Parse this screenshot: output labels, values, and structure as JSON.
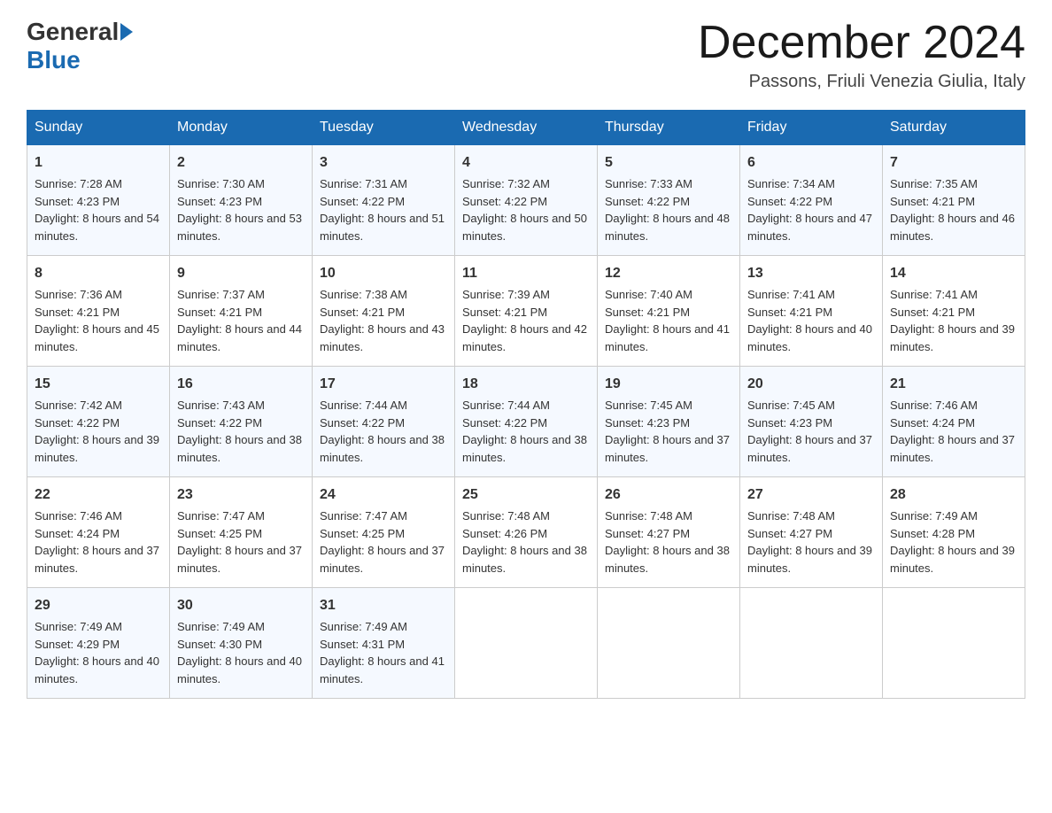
{
  "logo": {
    "general": "General",
    "blue": "Blue"
  },
  "title": "December 2024",
  "location": "Passons, Friuli Venezia Giulia, Italy",
  "days_of_week": [
    "Sunday",
    "Monday",
    "Tuesday",
    "Wednesday",
    "Thursday",
    "Friday",
    "Saturday"
  ],
  "weeks": [
    [
      {
        "day": "1",
        "sunrise": "7:28 AM",
        "sunset": "4:23 PM",
        "daylight": "8 hours and 54 minutes."
      },
      {
        "day": "2",
        "sunrise": "7:30 AM",
        "sunset": "4:23 PM",
        "daylight": "8 hours and 53 minutes."
      },
      {
        "day": "3",
        "sunrise": "7:31 AM",
        "sunset": "4:22 PM",
        "daylight": "8 hours and 51 minutes."
      },
      {
        "day": "4",
        "sunrise": "7:32 AM",
        "sunset": "4:22 PM",
        "daylight": "8 hours and 50 minutes."
      },
      {
        "day": "5",
        "sunrise": "7:33 AM",
        "sunset": "4:22 PM",
        "daylight": "8 hours and 48 minutes."
      },
      {
        "day": "6",
        "sunrise": "7:34 AM",
        "sunset": "4:22 PM",
        "daylight": "8 hours and 47 minutes."
      },
      {
        "day": "7",
        "sunrise": "7:35 AM",
        "sunset": "4:21 PM",
        "daylight": "8 hours and 46 minutes."
      }
    ],
    [
      {
        "day": "8",
        "sunrise": "7:36 AM",
        "sunset": "4:21 PM",
        "daylight": "8 hours and 45 minutes."
      },
      {
        "day": "9",
        "sunrise": "7:37 AM",
        "sunset": "4:21 PM",
        "daylight": "8 hours and 44 minutes."
      },
      {
        "day": "10",
        "sunrise": "7:38 AM",
        "sunset": "4:21 PM",
        "daylight": "8 hours and 43 minutes."
      },
      {
        "day": "11",
        "sunrise": "7:39 AM",
        "sunset": "4:21 PM",
        "daylight": "8 hours and 42 minutes."
      },
      {
        "day": "12",
        "sunrise": "7:40 AM",
        "sunset": "4:21 PM",
        "daylight": "8 hours and 41 minutes."
      },
      {
        "day": "13",
        "sunrise": "7:41 AM",
        "sunset": "4:21 PM",
        "daylight": "8 hours and 40 minutes."
      },
      {
        "day": "14",
        "sunrise": "7:41 AM",
        "sunset": "4:21 PM",
        "daylight": "8 hours and 39 minutes."
      }
    ],
    [
      {
        "day": "15",
        "sunrise": "7:42 AM",
        "sunset": "4:22 PM",
        "daylight": "8 hours and 39 minutes."
      },
      {
        "day": "16",
        "sunrise": "7:43 AM",
        "sunset": "4:22 PM",
        "daylight": "8 hours and 38 minutes."
      },
      {
        "day": "17",
        "sunrise": "7:44 AM",
        "sunset": "4:22 PM",
        "daylight": "8 hours and 38 minutes."
      },
      {
        "day": "18",
        "sunrise": "7:44 AM",
        "sunset": "4:22 PM",
        "daylight": "8 hours and 38 minutes."
      },
      {
        "day": "19",
        "sunrise": "7:45 AM",
        "sunset": "4:23 PM",
        "daylight": "8 hours and 37 minutes."
      },
      {
        "day": "20",
        "sunrise": "7:45 AM",
        "sunset": "4:23 PM",
        "daylight": "8 hours and 37 minutes."
      },
      {
        "day": "21",
        "sunrise": "7:46 AM",
        "sunset": "4:24 PM",
        "daylight": "8 hours and 37 minutes."
      }
    ],
    [
      {
        "day": "22",
        "sunrise": "7:46 AM",
        "sunset": "4:24 PM",
        "daylight": "8 hours and 37 minutes."
      },
      {
        "day": "23",
        "sunrise": "7:47 AM",
        "sunset": "4:25 PM",
        "daylight": "8 hours and 37 minutes."
      },
      {
        "day": "24",
        "sunrise": "7:47 AM",
        "sunset": "4:25 PM",
        "daylight": "8 hours and 37 minutes."
      },
      {
        "day": "25",
        "sunrise": "7:48 AM",
        "sunset": "4:26 PM",
        "daylight": "8 hours and 38 minutes."
      },
      {
        "day": "26",
        "sunrise": "7:48 AM",
        "sunset": "4:27 PM",
        "daylight": "8 hours and 38 minutes."
      },
      {
        "day": "27",
        "sunrise": "7:48 AM",
        "sunset": "4:27 PM",
        "daylight": "8 hours and 39 minutes."
      },
      {
        "day": "28",
        "sunrise": "7:49 AM",
        "sunset": "4:28 PM",
        "daylight": "8 hours and 39 minutes."
      }
    ],
    [
      {
        "day": "29",
        "sunrise": "7:49 AM",
        "sunset": "4:29 PM",
        "daylight": "8 hours and 40 minutes."
      },
      {
        "day": "30",
        "sunrise": "7:49 AM",
        "sunset": "4:30 PM",
        "daylight": "8 hours and 40 minutes."
      },
      {
        "day": "31",
        "sunrise": "7:49 AM",
        "sunset": "4:31 PM",
        "daylight": "8 hours and 41 minutes."
      },
      null,
      null,
      null,
      null
    ]
  ],
  "labels": {
    "sunrise": "Sunrise:",
    "sunset": "Sunset:",
    "daylight": "Daylight:"
  }
}
